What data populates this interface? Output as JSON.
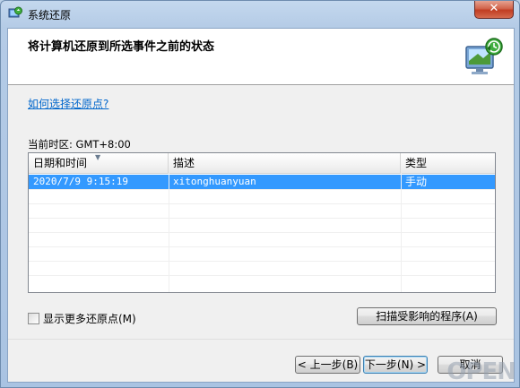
{
  "window": {
    "title": "系统还原",
    "close_label": "✕",
    "icon": "system-restore-icon"
  },
  "header": {
    "title": "将计算机还原到所选事件之前的状态",
    "icon": "monitor-restore-icon"
  },
  "help_link": "如何选择还原点?",
  "timezone": "当前时区: GMT+8:00",
  "table": {
    "columns": [
      "日期和时间",
      "描述",
      "类型"
    ],
    "rows": [
      {
        "datetime": "2020/7/9 9:15:19",
        "description": "xitonghuanyuan",
        "type": "手动",
        "selected": true
      }
    ]
  },
  "show_more": {
    "label": "显示更多还原点(M)",
    "checked": false
  },
  "scan_button": "扫描受影响的程序(A)",
  "footer": {
    "back": "< 上一步(B)",
    "next": "下一步(N) >",
    "cancel": "取消"
  },
  "watermark": "OPEN",
  "colors": {
    "selection": "#3399ff",
    "link": "#0066cc",
    "close": "#c13d22"
  }
}
